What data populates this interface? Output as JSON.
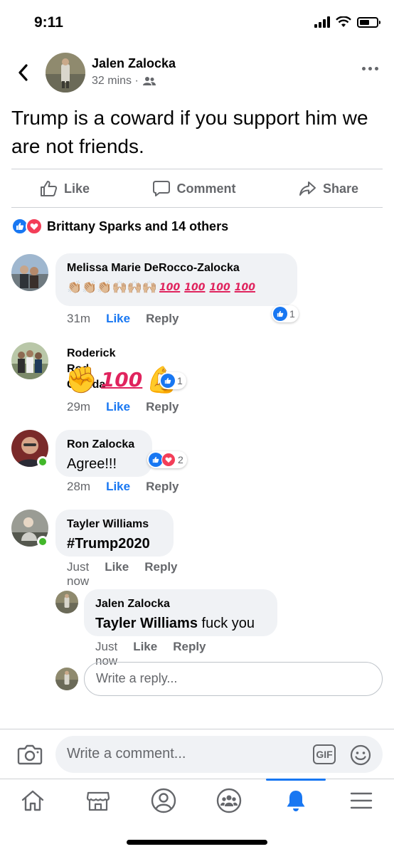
{
  "status_bar": {
    "time": "9:11"
  },
  "post": {
    "author": "Jalen Zalocka",
    "time": "32 mins ·",
    "text": "Trump is a coward if you support him we are not friends.",
    "actions": {
      "like": "Like",
      "comment": "Comment",
      "share": "Share"
    },
    "reactions_summary": "Brittany Sparks and 14 others"
  },
  "comments": [
    {
      "name": "Melissa Marie DeRocco-Zalocka",
      "emoji": "👏🏼👏🏼👏🏼🙌🏼🙌🏼🙌🏼",
      "hundreds": [
        "100",
        "100",
        "100",
        "100"
      ],
      "time": "31m",
      "like": "Like",
      "reply": "Reply",
      "reaction_count": "1"
    },
    {
      "name": "Roderick Rod Clarida",
      "emoji_a": "✊",
      "hundred": "100",
      "emoji_b": "💪",
      "time": "29m",
      "like": "Like",
      "reply": "Reply",
      "reaction_count": "1"
    },
    {
      "name": "Ron Zalocka",
      "text": "Agree!!!",
      "time": "28m",
      "like": "Like",
      "reply": "Reply",
      "reaction_count": "2"
    },
    {
      "name": "Tayler Williams",
      "text": "#Trump2020",
      "time": "Just now",
      "like": "Like",
      "reply": "Reply"
    }
  ],
  "reply": {
    "name": "Jalen Zalocka",
    "mention": "Tayler Williams",
    "text": " fuck you",
    "time": "Just now",
    "like": "Like",
    "reply": "Reply"
  },
  "reply_input": {
    "placeholder": "Write a reply..."
  },
  "composer": {
    "placeholder": "Write a comment...",
    "gif": "GIF"
  },
  "colors": {
    "accent": "#1877f2",
    "love": "#f33e58",
    "bubble": "#f0f2f5",
    "online": "#42b72a"
  },
  "icons": [
    "back-arrow",
    "more-dots",
    "friends",
    "like-thumb",
    "comment-bubble",
    "share-arrow",
    "camera",
    "gif",
    "emoji",
    "home",
    "marketplace",
    "profile",
    "groups",
    "bell",
    "menu"
  ],
  "tabs": {
    "active": "notifications"
  }
}
